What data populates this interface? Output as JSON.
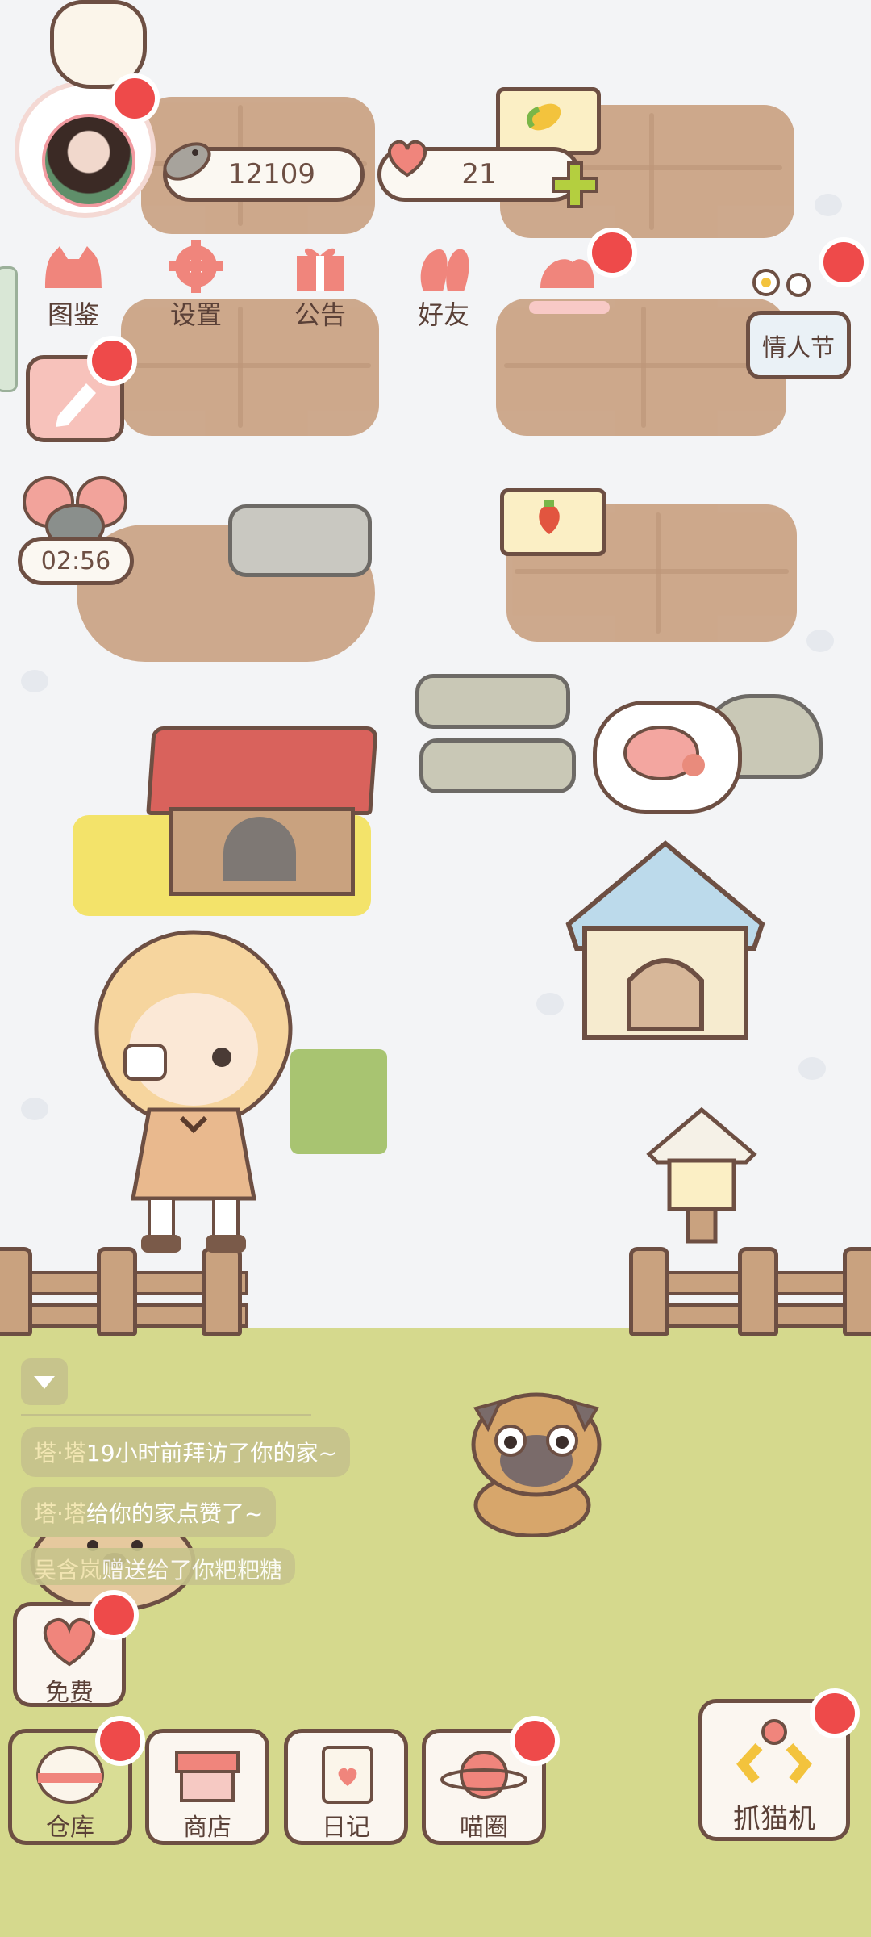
{
  "stats": {
    "coins": "12109",
    "hearts": "21"
  },
  "top_menu": [
    {
      "label": "图鉴",
      "icon": "cat-head-icon"
    },
    {
      "label": "设置",
      "icon": "gear-icon"
    },
    {
      "label": "公告",
      "icon": "gift-icon"
    },
    {
      "label": "好友",
      "icon": "friends-icon"
    }
  ],
  "event": {
    "label": "情人节"
  },
  "timer": "02:56",
  "chat_messages": [
    {
      "name": "塔·塔",
      "text": "19小时前拜访了你的家~"
    },
    {
      "name": "塔·塔",
      "text": "给你的家点赞了~"
    },
    {
      "name": "吴含岚",
      "text": "赠送给了你粑粑糖"
    }
  ],
  "free_button": {
    "label": "免费"
  },
  "bottom_nav": [
    {
      "label": "仓库",
      "icon": "warehouse-icon"
    },
    {
      "label": "商店",
      "icon": "shop-icon"
    },
    {
      "label": "日记",
      "icon": "diary-icon"
    },
    {
      "label": "喵圈",
      "icon": "cat-planet-icon"
    }
  ],
  "claw_machine": {
    "label": "抓猫机",
    "icon": "claw-icon"
  },
  "colors": {
    "grass": "#d5d98d",
    "soil": "#caa283",
    "badge": "#ee4a4a",
    "outline": "#6d4f43"
  }
}
